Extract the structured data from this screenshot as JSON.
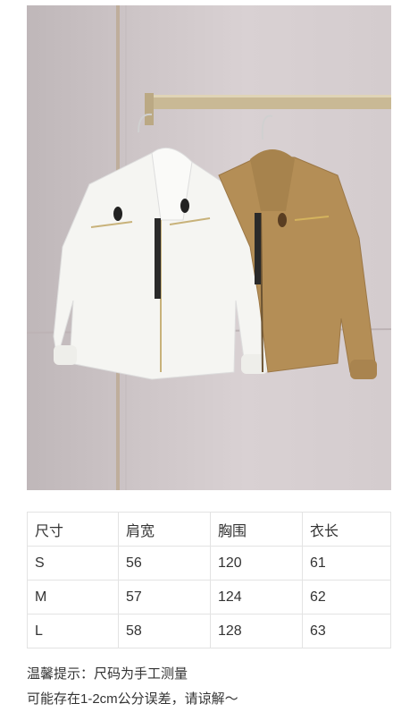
{
  "photo": {
    "description_icon": "jackets-photo"
  },
  "size_table": {
    "headers": [
      "尺寸",
      "肩宽",
      "胸围",
      "衣长"
    ],
    "rows": [
      [
        "S",
        "56",
        "120",
        "61"
      ],
      [
        "M",
        "57",
        "124",
        "62"
      ],
      [
        "L",
        "58",
        "128",
        "63"
      ]
    ]
  },
  "notes": {
    "line1": "温馨提示：尺码为手工测量",
    "line2": "可能存在1-2cm公分误差，请谅解～"
  }
}
